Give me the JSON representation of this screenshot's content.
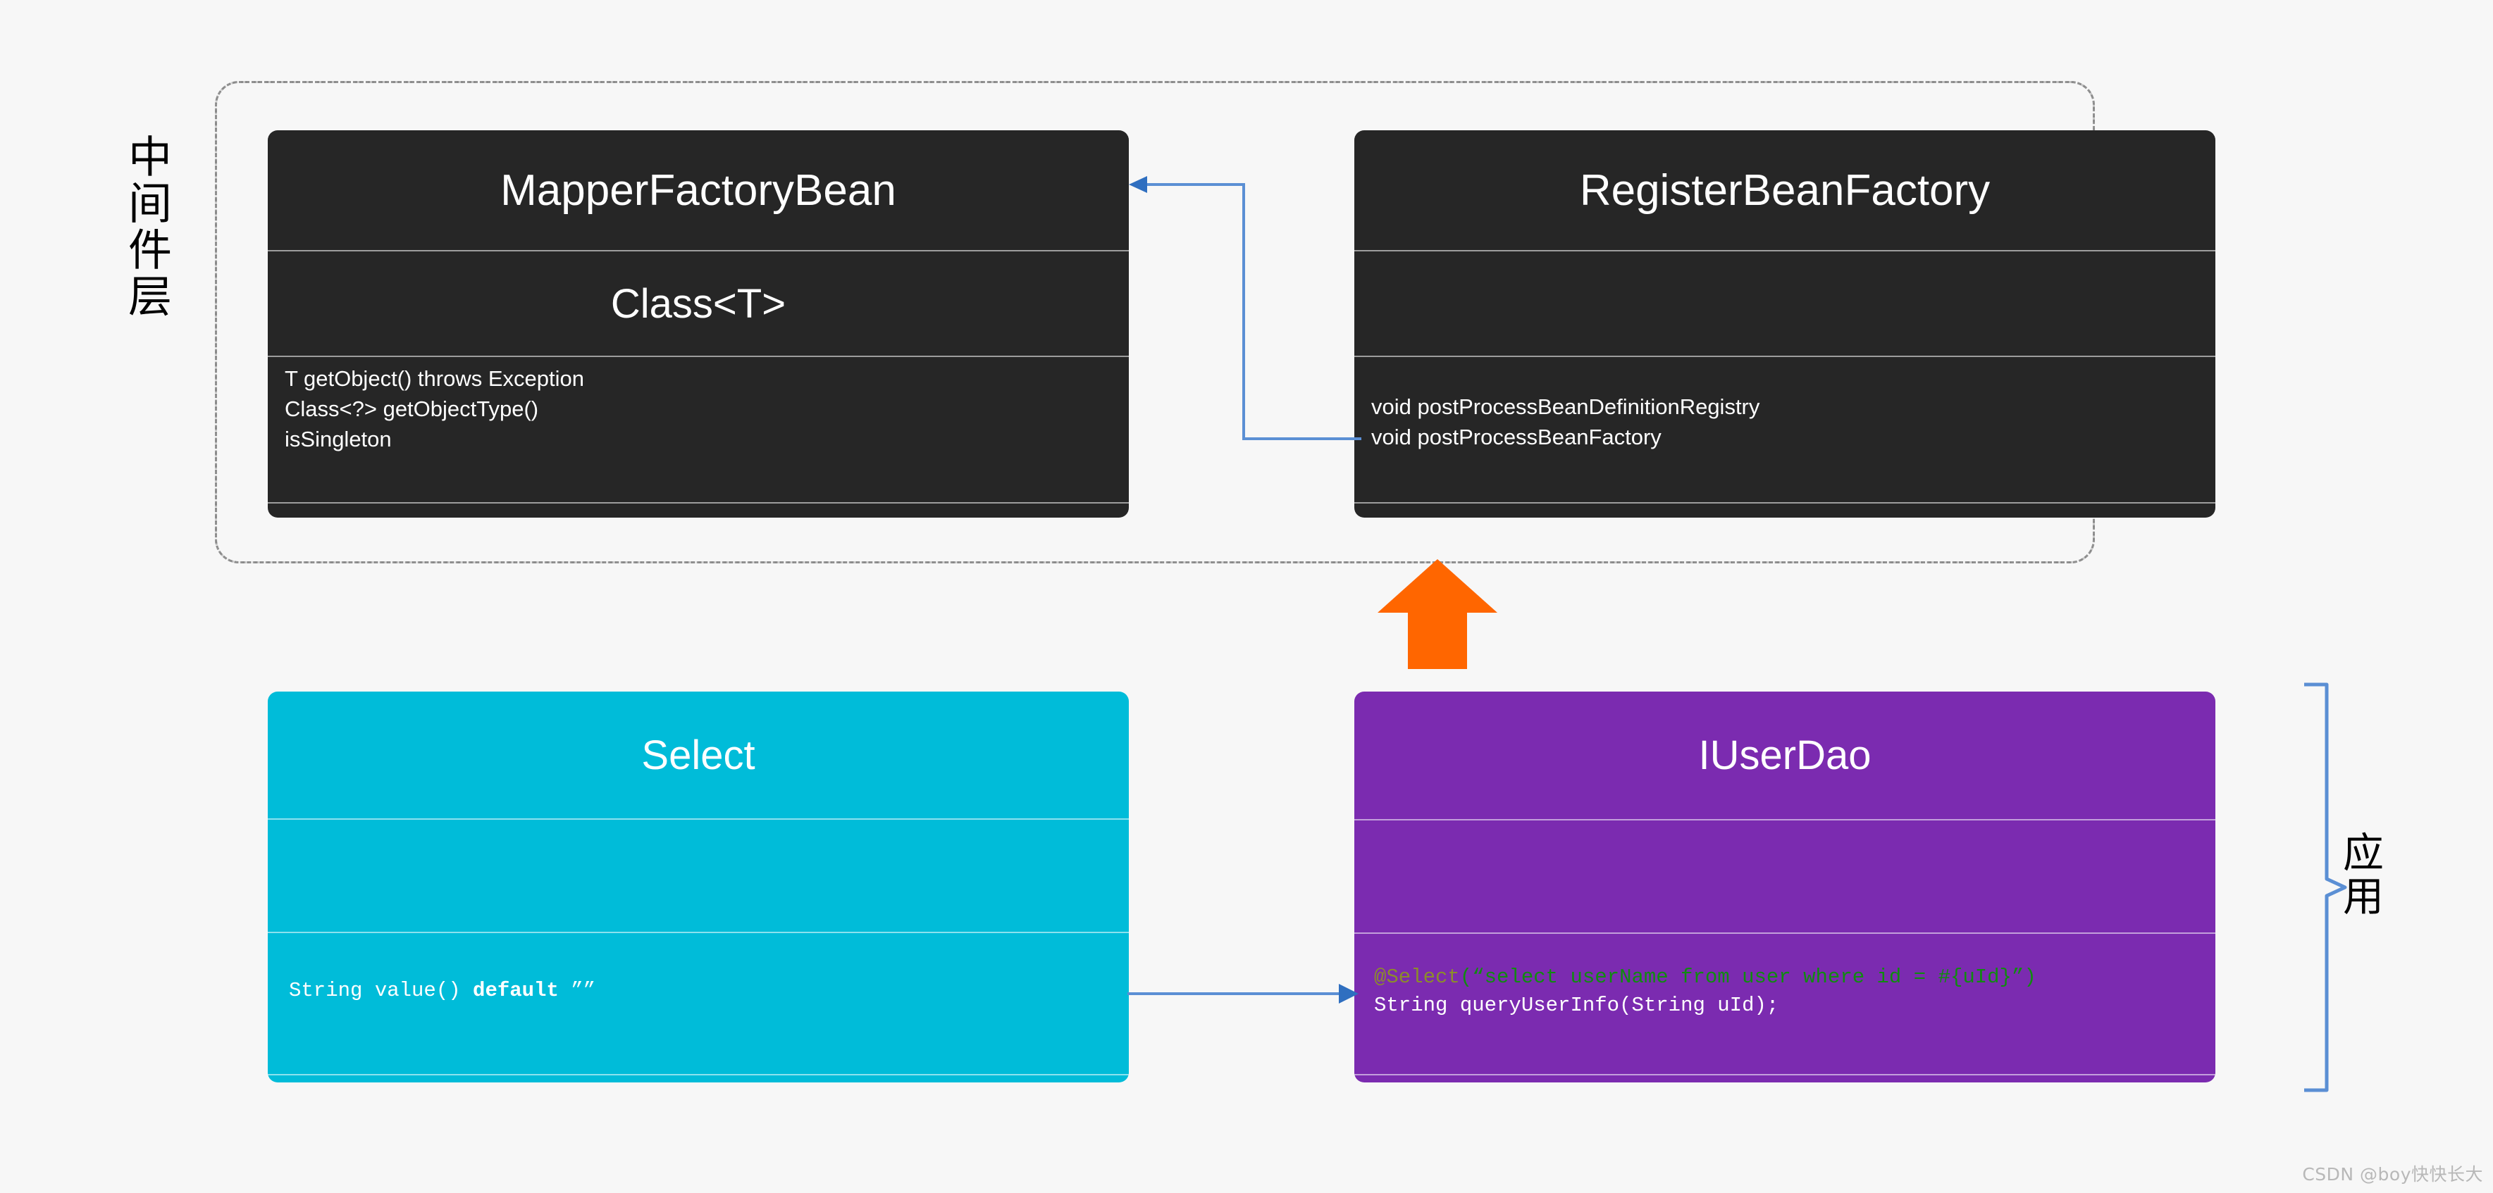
{
  "page": {
    "background": "#f7f7f7",
    "watermark": "CSDN @boy快快长大"
  },
  "layers": {
    "middleware": {
      "label": "中间件层",
      "border_color": "#8a8a8a",
      "border_style": "dash-dot"
    },
    "application": {
      "label": "应用",
      "brace_color": "#5b8fd4"
    }
  },
  "boxes": {
    "mapper_factory_bean": {
      "title": "MapperFactoryBean",
      "subtitle": "Class<T>",
      "members": [
        "T getObject() throws Exception",
        "Class<?> getObjectType()",
        "isSingleton"
      ],
      "fill": "#262626",
      "text_color": "#ffffff"
    },
    "register_bean_factory": {
      "title": "RegisterBeanFactory",
      "subtitle": "",
      "members": [
        "void postProcessBeanDefinitionRegistry",
        "void postProcessBeanFactory"
      ],
      "fill": "#262626",
      "text_color": "#ffffff"
    },
    "select_annotation": {
      "title": "Select",
      "subtitle": "",
      "members": [
        "String value() default \"\""
      ],
      "code": {
        "prefix": "String value() ",
        "keyword": "default",
        "suffix": " ””"
      },
      "fill": "#00bcd9",
      "text_color": "#ffffff"
    },
    "iuserdao": {
      "title": "IUserDao",
      "subtitle": "",
      "members": [
        "@Select(\"select userName from user where id = #{uId}\")",
        "String queryUserInfo(String uId);"
      ],
      "code": {
        "annotation": "@Select",
        "open_paren": "(",
        "sql_string": "“select userName from user where id = #{uId}”",
        "close_paren": ")",
        "method": "String queryUserInfo(String uId);"
      },
      "fill": "#7b2bb0",
      "text_color": "#ffffff"
    }
  },
  "connectors": {
    "register_to_mapper": {
      "from": "RegisterBeanFactory",
      "to": "MapperFactoryBean",
      "color": "#5b8fd4",
      "style": "stepped-arrow"
    },
    "select_to_iuserdao": {
      "from": "Select",
      "to": "IUserDao",
      "color": "#5b8fd4",
      "style": "straight-arrow"
    },
    "app_to_middleware": {
      "from": "IUserDao",
      "to": "RegisterBeanFactory",
      "color": "#ff6600",
      "style": "block-up-arrow"
    }
  }
}
